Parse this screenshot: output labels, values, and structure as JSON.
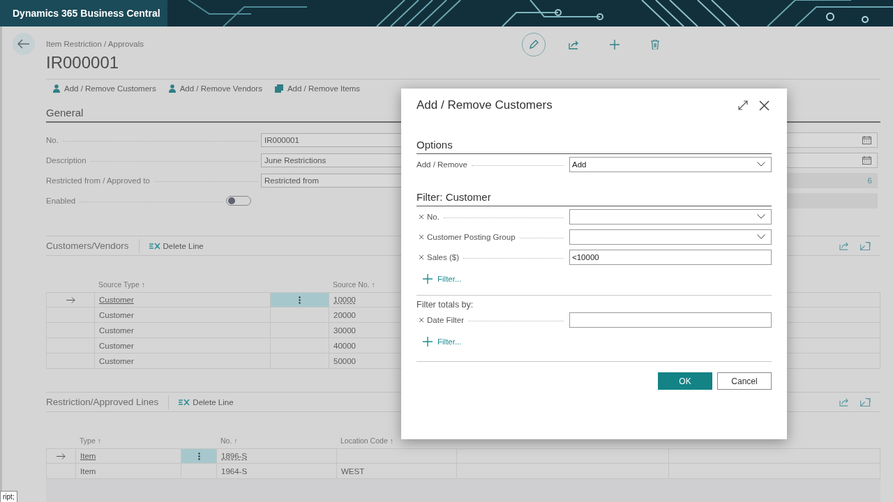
{
  "app_bar": {
    "title": "Dynamics 365 Business Central"
  },
  "page": {
    "breadcrumb": "Item Restriction / Approvals",
    "title": "IR000001"
  },
  "actions": [
    {
      "label": "Add / Remove Customers",
      "kind": "person"
    },
    {
      "label": "Add / Remove Vendors",
      "kind": "person"
    },
    {
      "label": "Add / Remove Items",
      "kind": "box"
    }
  ],
  "general": {
    "heading": "General",
    "fields": [
      {
        "label": "No.",
        "kind": "text",
        "value": "IR000001"
      },
      {
        "label": "Description",
        "kind": "text",
        "value": "June Restrictions"
      },
      {
        "label": "Restricted from / Approved to",
        "kind": "text",
        "value": "Restricted from"
      },
      {
        "label": "Enabled",
        "kind": "toggle",
        "on": false
      }
    ],
    "right_fields": [
      {
        "kind": "date"
      },
      {
        "kind": "date"
      },
      {
        "kind": "number",
        "value": "6"
      },
      {
        "kind": "readonly"
      }
    ]
  },
  "customers_vendors": {
    "title": "Customers/Vendors",
    "action": "Delete Line",
    "columns": [
      "Source Type ↑",
      "Source No. ↑"
    ],
    "rows": [
      {
        "source_type": "Customer",
        "source_no": "10000",
        "selected": true
      },
      {
        "source_type": "Customer",
        "source_no": "20000",
        "selected": false
      },
      {
        "source_type": "Customer",
        "source_no": "30000",
        "selected": false
      },
      {
        "source_type": "Customer",
        "source_no": "40000",
        "selected": false
      },
      {
        "source_type": "Customer",
        "source_no": "50000",
        "selected": false
      }
    ]
  },
  "lines": {
    "title": "Restriction/Approved Lines",
    "action": "Delete Line",
    "columns": [
      "Type ↑",
      "No. ↑",
      "Location Code ↑"
    ],
    "rows": [
      {
        "type": "Item",
        "no": "1896-S",
        "selected": true
      },
      {
        "type": "Item",
        "no": "1964-S",
        "location": "WEST",
        "selected": false
      }
    ]
  },
  "dialog": {
    "title": "Add / Remove Customers",
    "options": {
      "heading": "Options",
      "fields": [
        {
          "label": "Add / Remove",
          "kind": "select",
          "value": "Add",
          "removable": false
        }
      ]
    },
    "filter": {
      "heading": "Filter: Customer",
      "fields": [
        {
          "label": "No.",
          "kind": "select",
          "removable": true
        },
        {
          "label": "Customer Posting Group",
          "kind": "select",
          "removable": true
        },
        {
          "label": "Sales ($)",
          "kind": "text",
          "value": "<10000",
          "removable": true
        }
      ],
      "add_filter": "Filter..."
    },
    "totals": {
      "heading": "Filter totals by:",
      "fields": [
        {
          "label": "Date Filter",
          "kind": "text",
          "removable": true
        }
      ],
      "add_filter": "Filter..."
    },
    "buttons": [
      {
        "label": "OK",
        "primary": true
      },
      {
        "label": "Cancel",
        "primary": false
      }
    ]
  },
  "tooltip": "ript;"
}
